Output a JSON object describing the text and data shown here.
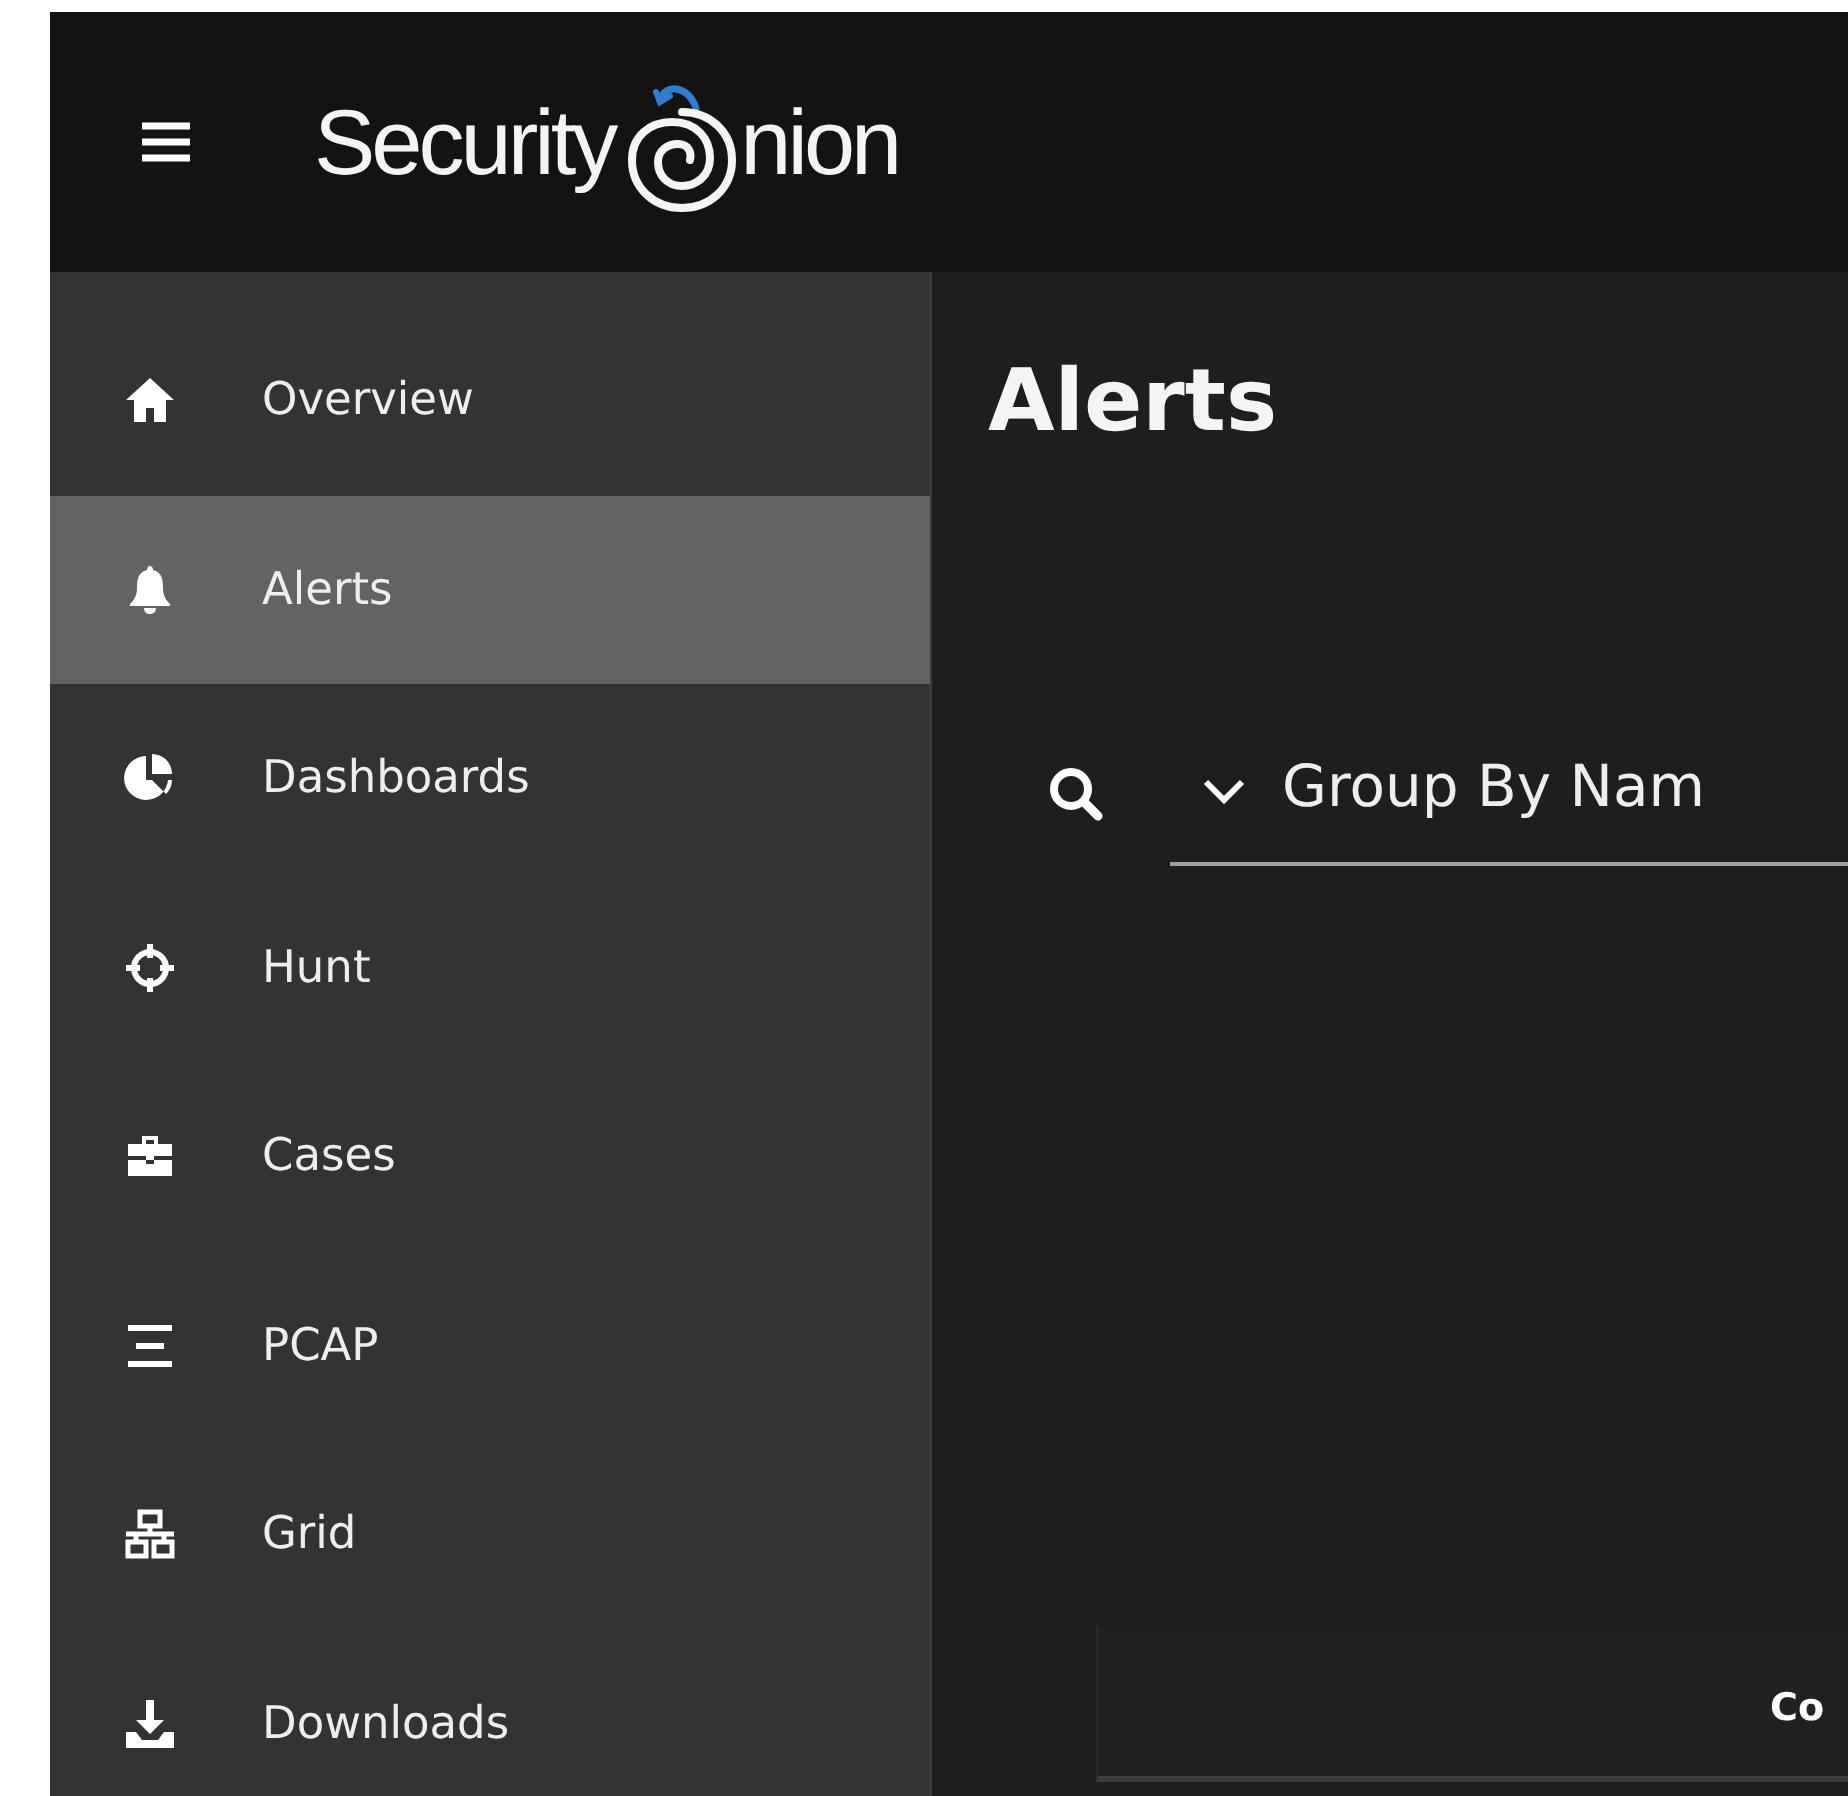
{
  "header": {
    "logo_parts": [
      "Security",
      "nion"
    ]
  },
  "sidebar": {
    "items": [
      {
        "label": "Overview",
        "selected": false
      },
      {
        "label": "Alerts",
        "selected": true
      },
      {
        "label": "Dashboards",
        "selected": false
      },
      {
        "label": "Hunt",
        "selected": false
      },
      {
        "label": "Cases",
        "selected": false
      },
      {
        "label": "PCAP",
        "selected": false
      },
      {
        "label": "Grid",
        "selected": false
      },
      {
        "label": "Downloads",
        "selected": false
      }
    ]
  },
  "main": {
    "title": "Alerts",
    "query": {
      "value": "Group By Nam"
    },
    "table": {
      "columns": [
        "Co"
      ]
    }
  }
}
